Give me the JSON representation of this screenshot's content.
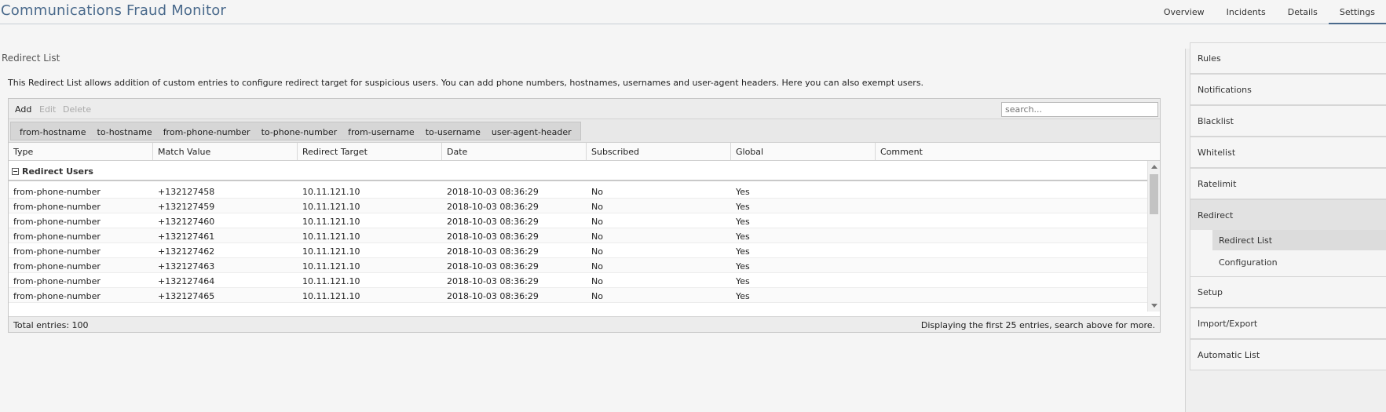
{
  "app": {
    "title": "Communications Fraud Monitor"
  },
  "nav": {
    "tabs": [
      {
        "label": "Overview",
        "active": false
      },
      {
        "label": "Incidents",
        "active": false
      },
      {
        "label": "Details",
        "active": false
      },
      {
        "label": "Settings",
        "active": true
      }
    ]
  },
  "page": {
    "section_title": "Redirect List",
    "description": "This Redirect List allows addition of custom entries to configure redirect target for suspicious users. You can add phone numbers, hostnames, usernames and user-agent headers. Here you can also exempt users."
  },
  "toolbar": {
    "add_label": "Add",
    "edit_label": "Edit",
    "delete_label": "Delete",
    "search_placeholder": "search..."
  },
  "filters": [
    "from-hostname",
    "to-hostname",
    "from-phone-number",
    "to-phone-number",
    "from-username",
    "to-username",
    "user-agent-header"
  ],
  "table": {
    "columns": [
      "Type",
      "Match Value",
      "Redirect Target",
      "Date",
      "Subscribed",
      "Global",
      "Comment"
    ],
    "group_label": "Redirect Users",
    "rows": [
      [
        "from-phone-number",
        "+132127458",
        "10.11.121.10",
        "2018-10-03 08:36:29",
        "No",
        "Yes",
        ""
      ],
      [
        "from-phone-number",
        "+132127459",
        "10.11.121.10",
        "2018-10-03 08:36:29",
        "No",
        "Yes",
        ""
      ],
      [
        "from-phone-number",
        "+132127460",
        "10.11.121.10",
        "2018-10-03 08:36:29",
        "No",
        "Yes",
        ""
      ],
      [
        "from-phone-number",
        "+132127461",
        "10.11.121.10",
        "2018-10-03 08:36:29",
        "No",
        "Yes",
        ""
      ],
      [
        "from-phone-number",
        "+132127462",
        "10.11.121.10",
        "2018-10-03 08:36:29",
        "No",
        "Yes",
        ""
      ],
      [
        "from-phone-number",
        "+132127463",
        "10.11.121.10",
        "2018-10-03 08:36:29",
        "No",
        "Yes",
        ""
      ],
      [
        "from-phone-number",
        "+132127464",
        "10.11.121.10",
        "2018-10-03 08:36:29",
        "No",
        "Yes",
        ""
      ],
      [
        "from-phone-number",
        "+132127465",
        "10.11.121.10",
        "2018-10-03 08:36:29",
        "No",
        "Yes",
        ""
      ]
    ],
    "total_label": "Total entries: 100",
    "display_message": "Displaying the first 25 entries, search above for more."
  },
  "sidebar": {
    "items_top": [
      "Rules",
      "Notifications",
      "Blacklist",
      "Whitelist",
      "Ratelimit"
    ],
    "group": {
      "label": "Redirect",
      "subitems": [
        {
          "label": "Redirect List",
          "active": true
        },
        {
          "label": "Configuration",
          "active": false
        }
      ]
    },
    "items_bottom": [
      "Setup",
      "Import/Export",
      "Automatic List"
    ]
  },
  "icons": {
    "group_toggle": "collapse-icon",
    "scroll_up": "arrow-up-icon",
    "scroll_down": "arrow-down-icon"
  },
  "colors": {
    "title_blue": "#4a6a8c",
    "background": "#f5f5f5"
  }
}
